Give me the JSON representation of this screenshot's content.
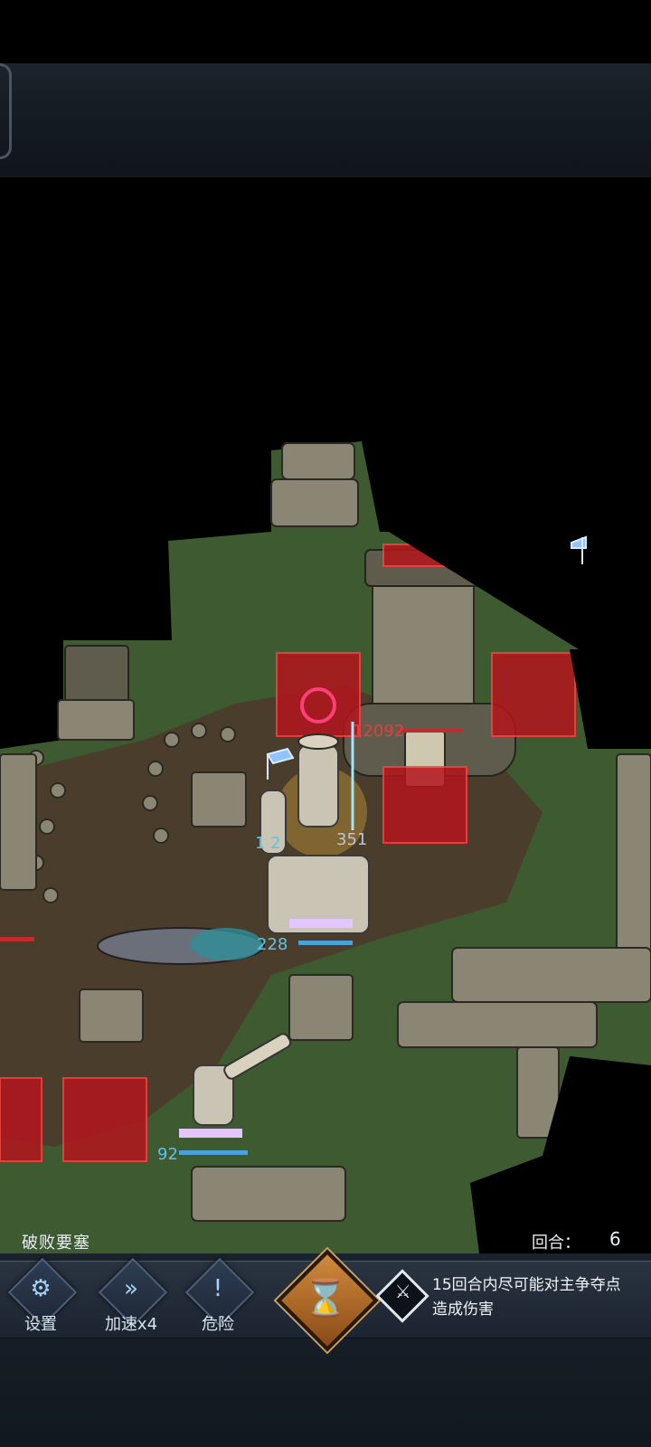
{
  "stage": {
    "name": "破败要塞"
  },
  "round": {
    "label": "回合：",
    "value": "6"
  },
  "map_numbers": {
    "tower_hp": "12092",
    "unit_left_hp": "1 2",
    "unit_center_hp": "351",
    "unit_mounted_hp": "228",
    "unit_bottom_hp": "92"
  },
  "buttons": {
    "settings": {
      "label": "设置",
      "icon": "gears-icon"
    },
    "speed": {
      "label": "加速x4",
      "icon": "fast-forward-icon"
    },
    "danger": {
      "label": "危险",
      "icon": "exclamation-icon"
    },
    "end_turn": {
      "icon": "hourglass-icon"
    }
  },
  "objective": {
    "icon": "crossed-swords-icon",
    "text_line1": "15回合内尽可能对主争夺点",
    "text_line2": "造成伤害"
  },
  "colors": {
    "danger_tile": "#b3161c",
    "ally_number": "#5fc2e8",
    "enemy_number": "#e23f3f",
    "end_turn_button": "#d08b3c"
  }
}
